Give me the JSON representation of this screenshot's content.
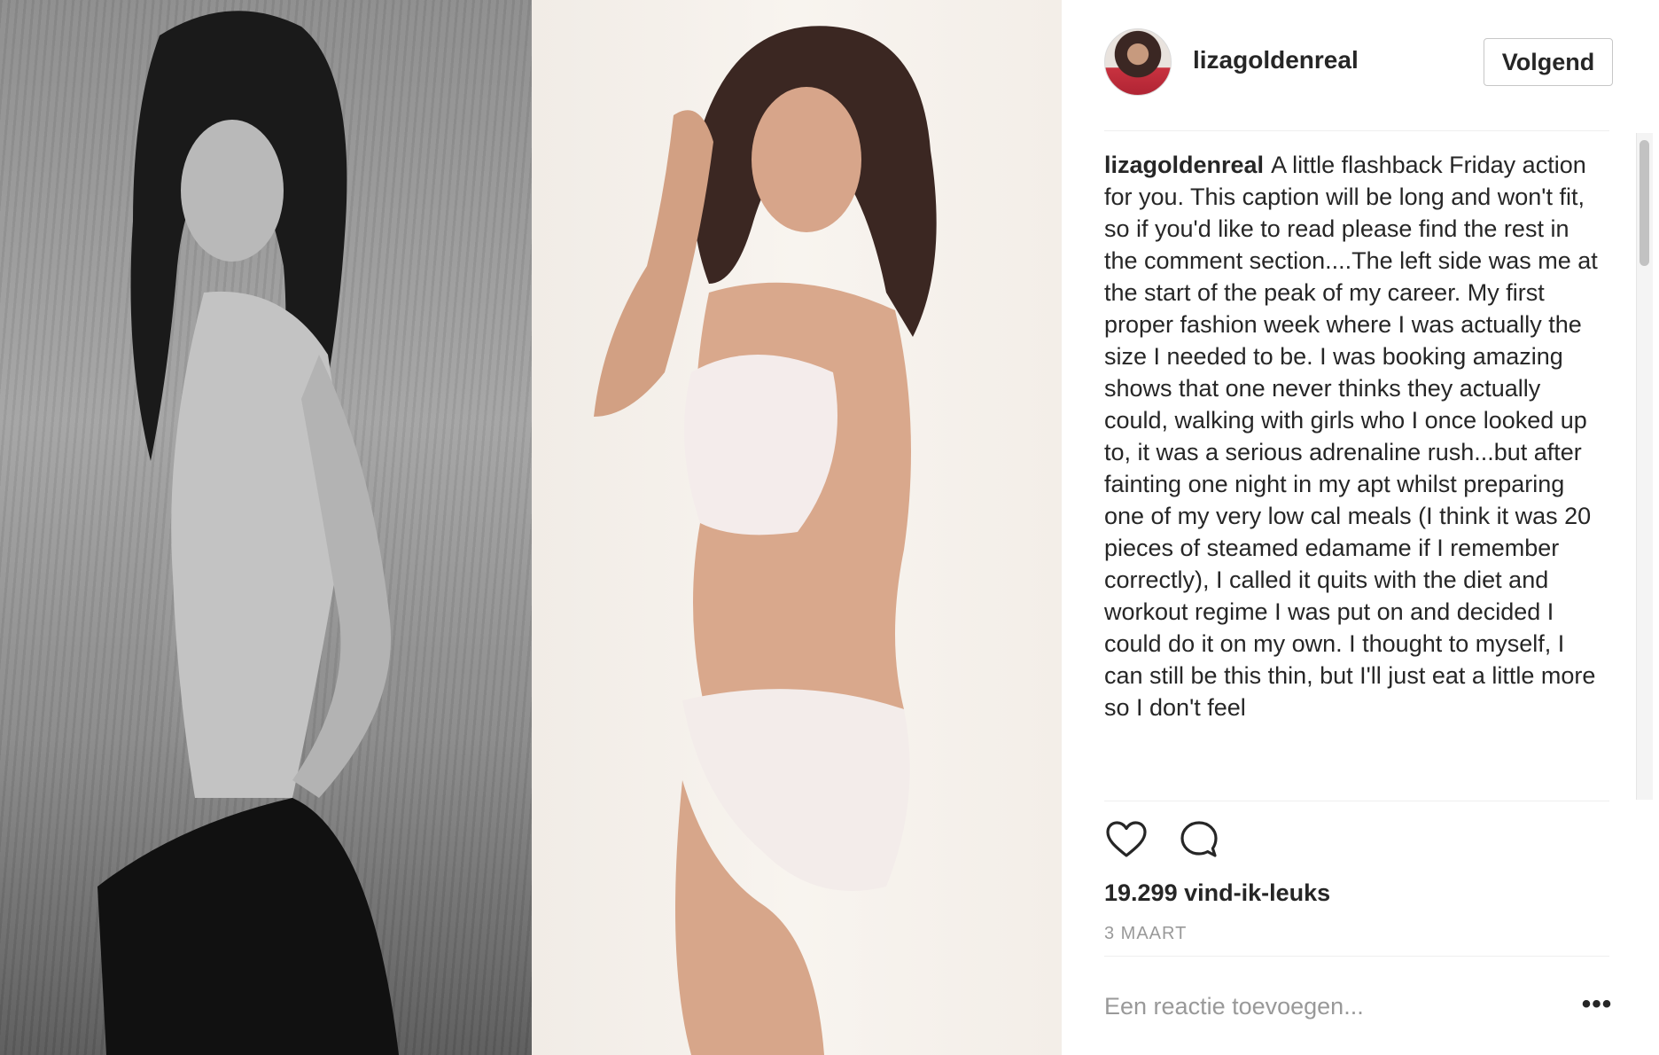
{
  "post": {
    "username": "lizagoldenreal",
    "follow_label": "Volgend",
    "caption_username": "lizagoldenreal",
    "caption_text": "A little flashback Friday action for you. This caption will be long and won't fit, so if you'd like to read please find the rest in the comment section....The left side was me at the start of the peak of my career. My first proper fashion week where I was actually the size I needed to be. I was booking amazing shows that one never thinks they actually could, walking with girls who I once looked up to, it was a serious adrenaline rush...but after fainting one night in my apt whilst preparing one of my very low cal meals (I think it was 20 pieces of steamed edamame if I remember correctly), I called it quits with the diet and workout regime I was put on and decided I could do it on my own. I thought to myself, I can still be this thin, but I'll just eat a little more so I don't feel",
    "likes": "19.299 vind-ik-leuks",
    "date": "3 MAART",
    "comment_placeholder": "Een reactie toevoegen...",
    "more_label": "•••"
  },
  "icons": {
    "like": "heart-icon",
    "comment": "comment-bubble-icon",
    "more": "more-options-icon"
  },
  "colors": {
    "text": "#262626",
    "secondary_text": "#999999",
    "divider": "#efefef",
    "button_border": "#c7c7c7"
  }
}
